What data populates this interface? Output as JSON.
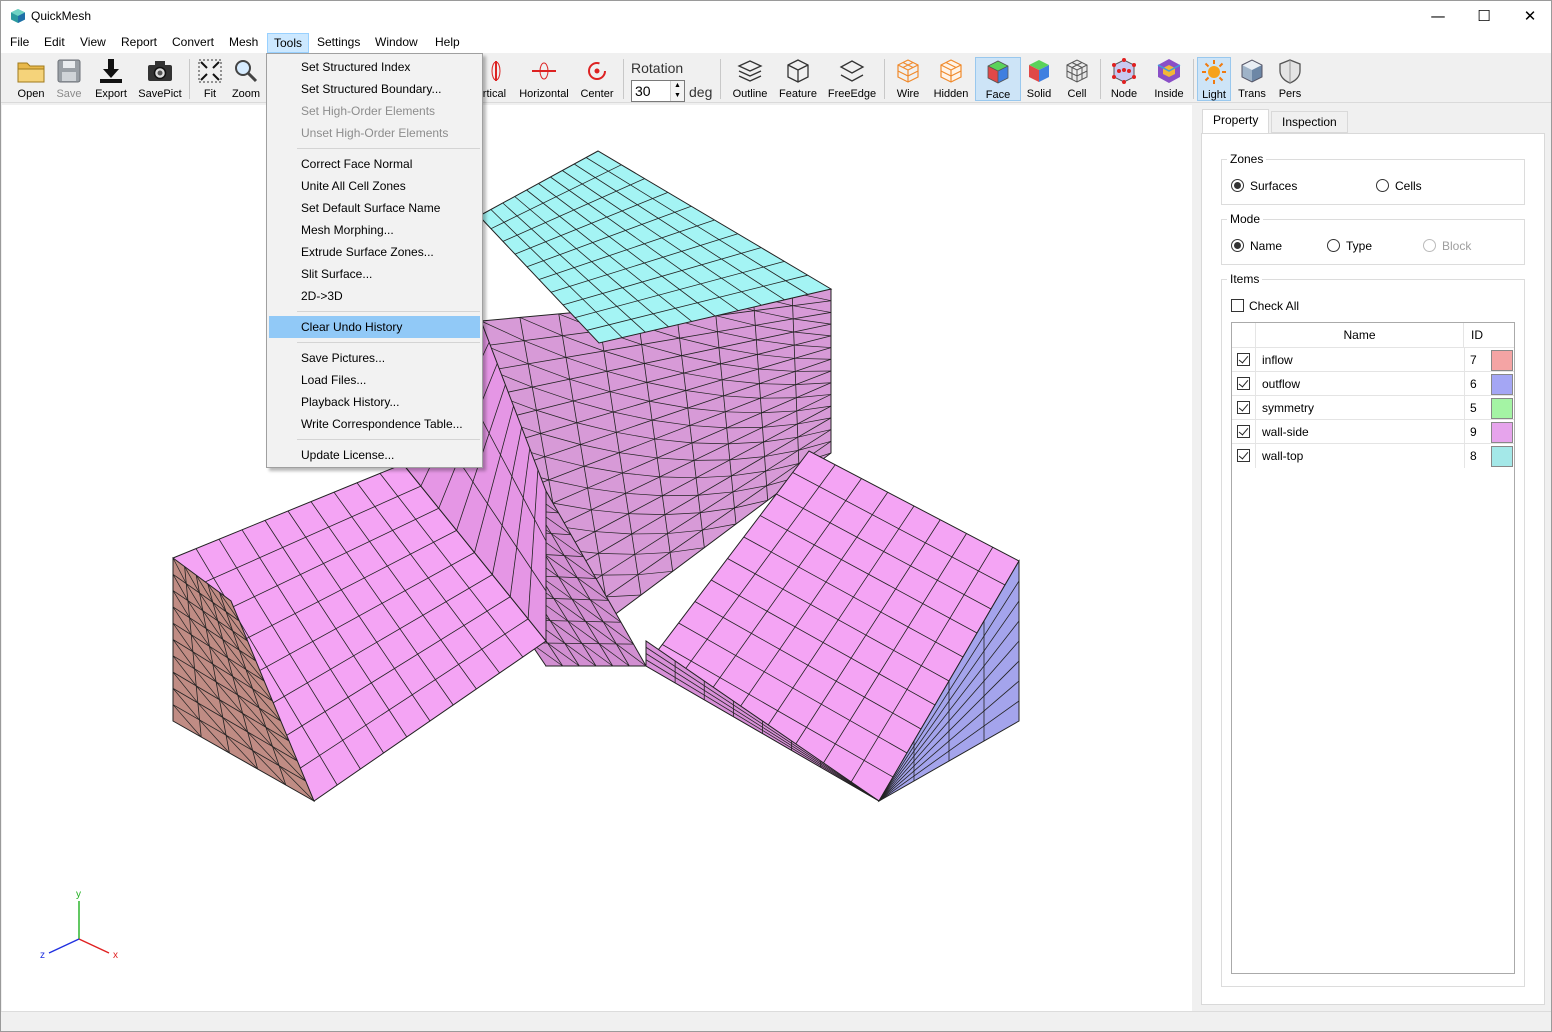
{
  "window": {
    "title": "QuickMesh",
    "minimize": "—",
    "maximize": "☐",
    "close": "✕"
  },
  "menubar": [
    "File",
    "Edit",
    "View",
    "Report",
    "Convert",
    "Mesh",
    "Tools",
    "Settings",
    "Window",
    "Help"
  ],
  "toolbar": {
    "open": "Open",
    "save": "Save",
    "export": "Export",
    "savepict": "SavePict",
    "fit": "Fit",
    "zoom": "Zoom",
    "vertical": "Vertical",
    "horizontal": "Horizontal",
    "center": "Center",
    "rotation_label": "Rotation",
    "rotation_value": "30",
    "rotation_unit": "deg",
    "outline": "Outline",
    "feature": "Feature",
    "freeedge": "FreeEdge",
    "wire": "Wire",
    "hidden": "Hidden",
    "face": "Face",
    "solid": "Solid",
    "cell": "Cell",
    "node": "Node",
    "inside": "Inside",
    "light": "Light",
    "trans": "Trans",
    "pers": "Pers"
  },
  "tools_menu": [
    {
      "label": "Set Structured Index",
      "disabled": false
    },
    {
      "label": "Set Structured Boundary...",
      "disabled": false
    },
    {
      "label": "Set High-Order Elements",
      "disabled": true
    },
    {
      "label": "Unset High-Order Elements",
      "disabled": true
    },
    {
      "sep": true
    },
    {
      "label": "Correct Face Normal",
      "disabled": false
    },
    {
      "label": "Unite All Cell Zones",
      "disabled": false
    },
    {
      "label": "Set Default Surface Name",
      "disabled": false
    },
    {
      "label": "Mesh Morphing...",
      "disabled": false
    },
    {
      "label": "Extrude Surface Zones...",
      "disabled": false
    },
    {
      "label": "Slit Surface...",
      "disabled": false
    },
    {
      "label": "2D->3D",
      "disabled": false
    },
    {
      "sep": true
    },
    {
      "label": "Clear Undo History",
      "disabled": false,
      "highlighted": true
    },
    {
      "sep": true
    },
    {
      "label": "Save Pictures...",
      "disabled": false
    },
    {
      "label": "Load Files...",
      "disabled": false
    },
    {
      "label": "Playback History...",
      "disabled": false
    },
    {
      "label": "Write Correspondence Table...",
      "disabled": false
    },
    {
      "sep": true
    },
    {
      "label": "Update License...",
      "disabled": false
    }
  ],
  "panel": {
    "tabs": [
      "Property",
      "Inspection"
    ],
    "zones": {
      "label": "Zones",
      "options": [
        "Surfaces",
        "Cells"
      ],
      "selected": "Surfaces"
    },
    "mode": {
      "label": "Mode",
      "options": [
        "Name",
        "Type",
        "Block"
      ],
      "selected": "Name",
      "disabled": [
        "Block"
      ]
    },
    "items": {
      "label": "Items",
      "check_all": "Check All",
      "columns": [
        "Name",
        "ID"
      ],
      "rows": [
        {
          "name": "inflow",
          "id": "7",
          "color": "#f4a4a4",
          "checked": true
        },
        {
          "name": "outflow",
          "id": "6",
          "color": "#a4a6f4",
          "checked": true
        },
        {
          "name": "symmetry",
          "id": "5",
          "color": "#a4f4a4",
          "checked": true
        },
        {
          "name": "wall-side",
          "id": "9",
          "color": "#e6a4ec",
          "checked": true
        },
        {
          "name": "wall-top",
          "id": "8",
          "color": "#a4e8e8",
          "checked": true
        }
      ]
    }
  },
  "axes": {
    "x": "x",
    "y": "y",
    "z": "z"
  },
  "colors": {
    "wall_top": "#a4f4f4",
    "wall_side": "#f4a4f4",
    "inflow": "#c08c84",
    "outflow": "#a4a4ec",
    "menu_highlight": "#91c9f7"
  }
}
